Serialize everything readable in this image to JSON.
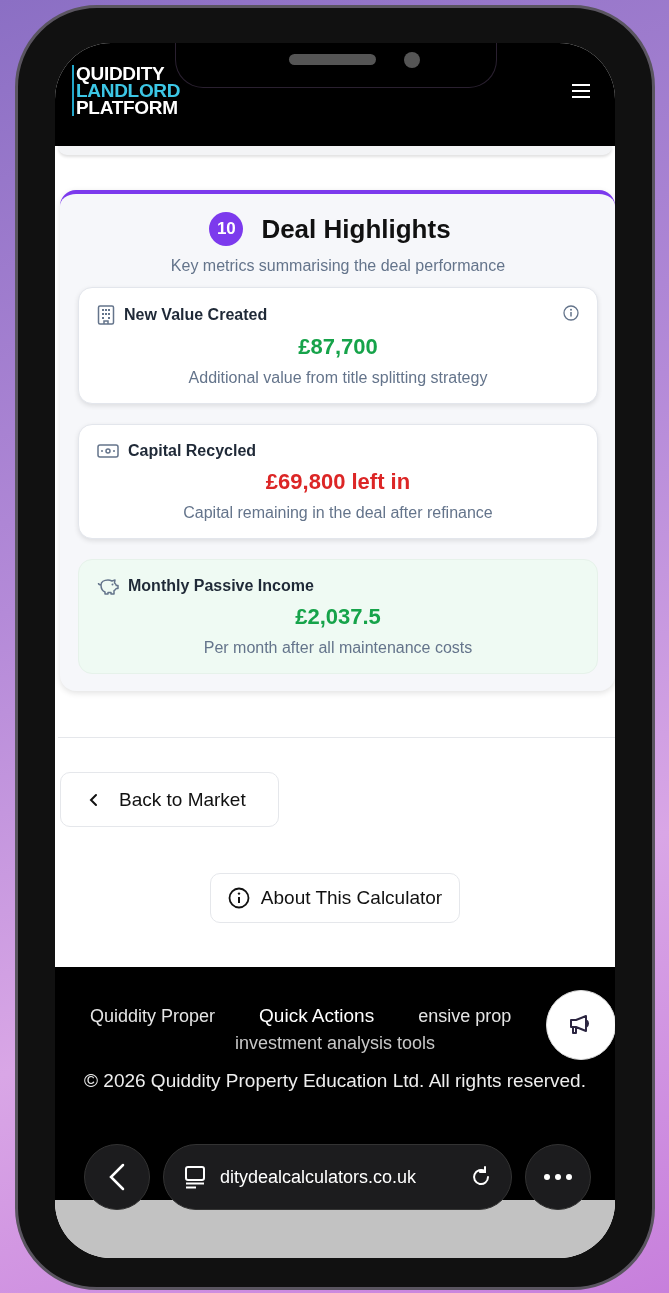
{
  "header": {
    "logo_lines": [
      "QUIDDITY",
      "LANDLORD",
      "PLATFORM"
    ]
  },
  "section": {
    "number": "10",
    "title": "Deal Highlights",
    "subtitle": "Key metrics summarising the deal performance",
    "metrics": [
      {
        "kind": "building",
        "title": "New Value Created",
        "value": "£87,700",
        "color": "#16a34a",
        "note": "Additional value from title splitting strategy",
        "info": true,
        "highlighted": false
      },
      {
        "kind": "cash",
        "title": "Capital Recycled",
        "value": "£69,800 left in",
        "color": "#dc2626",
        "note": "Capital remaining in the deal after refinance",
        "info": false,
        "highlighted": false
      },
      {
        "kind": "piggy",
        "title": "Monthly Passive Income",
        "value": "£2,037.5",
        "color": "#16a34a",
        "note": "Per month after all maintenance costs",
        "info": false,
        "highlighted": true
      }
    ]
  },
  "nav": {
    "back": "Back to Market",
    "about": "About This Calculator"
  },
  "footer": {
    "fragments": [
      "Quiddity Proper",
      "ensive prop"
    ],
    "tooltip": "Quick Actions",
    "line_2": "investment analysis tools",
    "copyright": "© 2026 Quiddity Property Education Ltd. All rights reserved."
  },
  "browser": {
    "url": "ditydealcalculators.co.uk"
  }
}
